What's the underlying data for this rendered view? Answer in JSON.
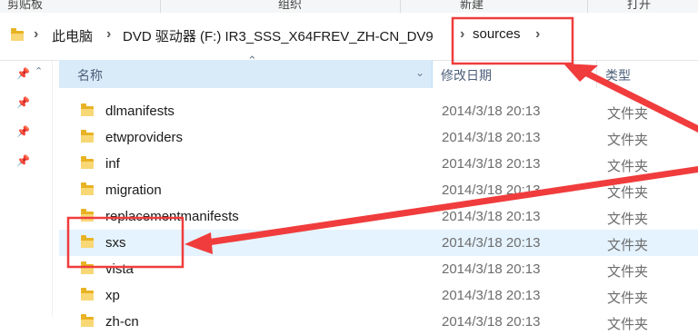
{
  "ribbon": {
    "groups": [
      "剪贴板",
      "组织",
      "新建",
      "打开"
    ]
  },
  "addressbar": {
    "crumbs": [
      "此电脑",
      "DVD 驱动器 (F:) IR3_SSS_X64FREV_ZH-CN_DV9",
      "sources"
    ]
  },
  "columns": {
    "name": "名称",
    "date": "修改日期",
    "type": "类型"
  },
  "files": [
    {
      "name": "dlmanifests",
      "date": "2014/3/18 20:13",
      "type": "文件夹"
    },
    {
      "name": "etwproviders",
      "date": "2014/3/18 20:13",
      "type": "文件夹"
    },
    {
      "name": "inf",
      "date": "2014/3/18 20:13",
      "type": "文件夹"
    },
    {
      "name": "migration",
      "date": "2014/3/18 20:13",
      "type": "文件夹"
    },
    {
      "name": "replacementmanifests",
      "date": "2014/3/18 20:13",
      "type": "文件夹"
    },
    {
      "name": "sxs",
      "date": "2014/3/18 20:13",
      "type": "文件夹",
      "selected": true
    },
    {
      "name": "vista",
      "date": "2014/3/18 20:13",
      "type": "文件夹"
    },
    {
      "name": "xp",
      "date": "2014/3/18 20:13",
      "type": "文件夹"
    },
    {
      "name": "zh-cn",
      "date": "2014/3/18 20:13",
      "type": "文件夹"
    }
  ],
  "colors": {
    "annotation": "#f03c3c",
    "selection": "#e5f3ff",
    "header_highlight": "#d9ebf9",
    "folder": "#e8b322"
  }
}
